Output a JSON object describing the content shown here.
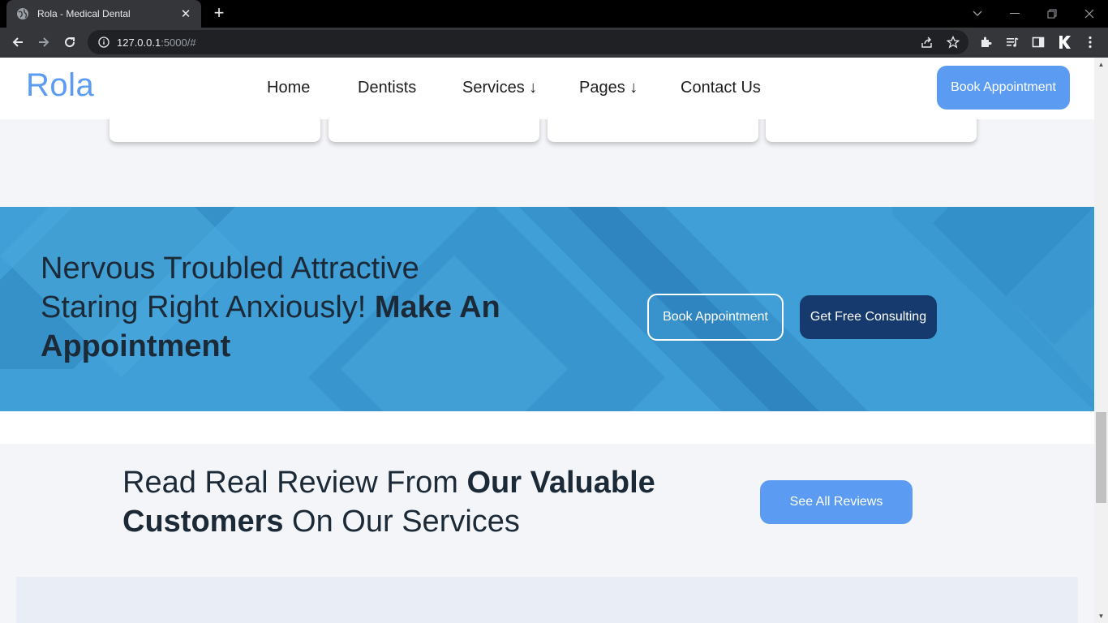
{
  "browser": {
    "tab_title": "Rola - Medical Dental",
    "url_host": "127.0.0.1",
    "url_path": ":5000/#",
    "accent": "#35363a"
  },
  "site": {
    "logo": "Rola",
    "brand_color": "#5b9cf2",
    "nav": [
      "Home",
      "Dentists",
      "Services ↓",
      "Pages ↓",
      "Contact Us"
    ],
    "header_button": "Book Appointment"
  },
  "cta": {
    "line1": "Nervous Troubled Attractive",
    "line2_regular": "Staring Right Anxiously! ",
    "line2_bold": "Make An",
    "line3_bold": "Appointment",
    "book_button": "Book Appointment",
    "consult_button": "Get Free Consulting",
    "band_color": "#3f9fd6",
    "dark_button_color": "#173a6e"
  },
  "reviews": {
    "title_part1": "Read Real Review From ",
    "title_bold1": "Our Valuable",
    "title_bold2": "Customers",
    "title_part2": " On Our Services",
    "button": "See All Reviews"
  }
}
